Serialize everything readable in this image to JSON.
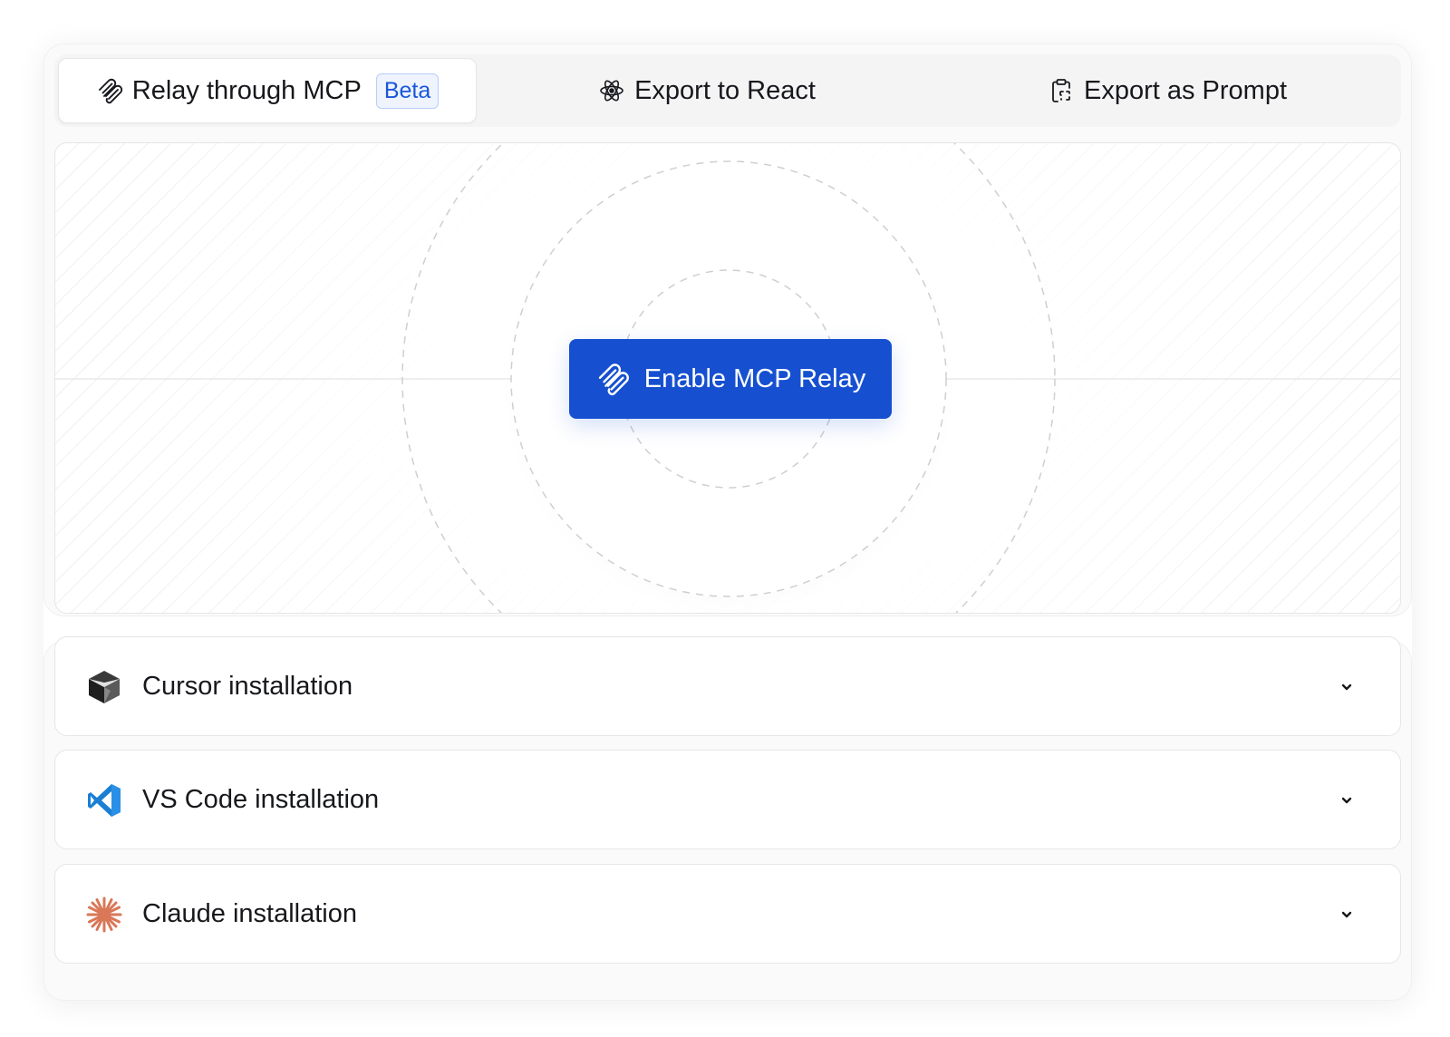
{
  "tabs": [
    {
      "label": "Relay through MCP",
      "badge": "Beta",
      "icon": "paperclip-icon",
      "active": true
    },
    {
      "label": "Export to React",
      "icon": "react-atom-icon",
      "active": false
    },
    {
      "label": "Export as Prompt",
      "icon": "clipboard-icon",
      "active": false
    }
  ],
  "stage": {
    "enable_button_label": "Enable MCP Relay",
    "button_color": "#1650d0"
  },
  "installations": [
    {
      "label": "Cursor installation",
      "icon": "cursor-logo-icon"
    },
    {
      "label": "VS Code installation",
      "icon": "vscode-logo-icon",
      "color": "#1a7fd4"
    },
    {
      "label": "Claude installation",
      "icon": "claude-logo-icon",
      "color": "#d97757"
    }
  ],
  "colors": {
    "accent": "#1650d0",
    "badge_text": "#1a56db"
  }
}
